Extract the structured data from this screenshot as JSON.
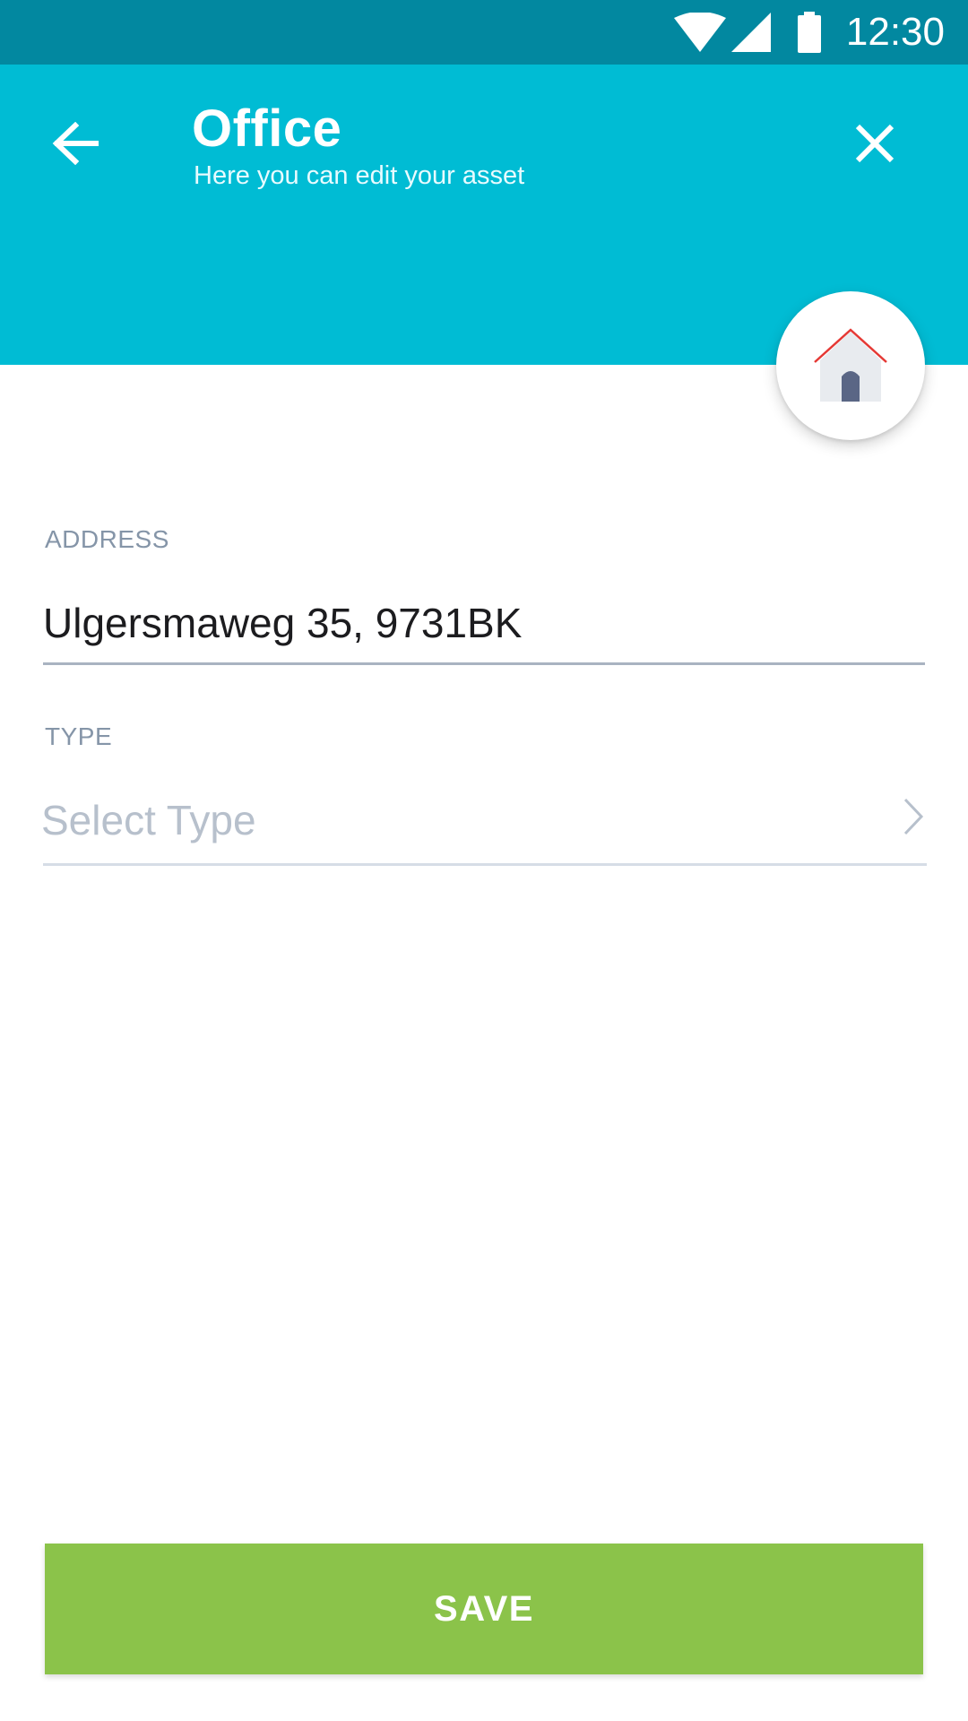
{
  "status_bar": {
    "time": "12:30",
    "icons": [
      "wifi-icon",
      "signal-icon",
      "battery-icon"
    ]
  },
  "header": {
    "title": "Office",
    "subtitle": "Here you can edit your asset",
    "back_icon": "arrow-left-icon",
    "close_icon": "close-icon",
    "background_color": "#00bcd4"
  },
  "asset_icon": "house-icon",
  "form": {
    "address": {
      "label": "ADDRESS",
      "value": "Ulgersmaweg 35, 9731BK"
    },
    "type": {
      "label": "TYPE",
      "placeholder": "Select Type",
      "icon": "chevron-right-icon"
    }
  },
  "actions": {
    "save_label": "SAVE",
    "save_color": "#8bc34a"
  }
}
